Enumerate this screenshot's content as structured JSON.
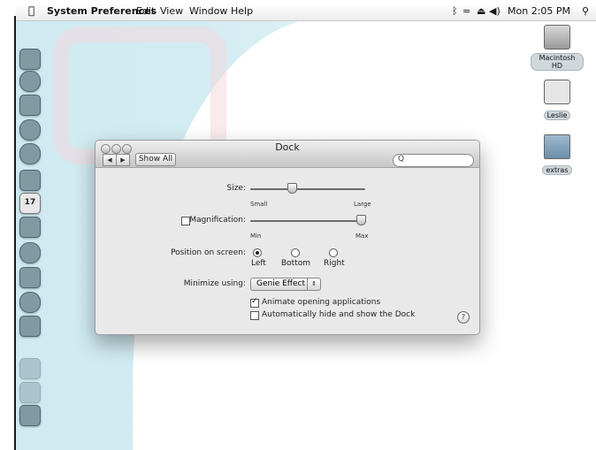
{
  "menubar": {
    "app_name": "System Preferences",
    "items": [
      "Edit",
      "View",
      "Window",
      "Help"
    ],
    "clock": "Mon 2:05 PM"
  },
  "window": {
    "title": "Dock",
    "nav_back": "◀",
    "nav_forward": "▶",
    "show_all": "Show All",
    "search_placeholder": "",
    "size": {
      "label": "Size:",
      "min_label": "Small",
      "max_label": "Large",
      "value": 0.35
    },
    "magnification": {
      "label": "Magnification:",
      "checked": false,
      "min_label": "Min",
      "max_label": "Max",
      "value": 1.0
    },
    "position": {
      "label": "Position on screen:",
      "options": [
        "Left",
        "Bottom",
        "Right"
      ],
      "selected": "Left"
    },
    "minimize": {
      "label": "Minimize using:",
      "value": "Genie Effect"
    },
    "animate_label": "Animate opening applications",
    "animate_checked": true,
    "autohide_label": "Automatically hide and show the Dock",
    "autohide_checked": false,
    "help": "?"
  },
  "desktop_icons": [
    {
      "label": "Macintosh HD",
      "icon": "hard-drive-icon"
    },
    {
      "label": "Leslie",
      "icon": "document-icon"
    },
    {
      "label": "extras",
      "icon": "folder-icon"
    }
  ],
  "dock_icons": [
    "finder-icon",
    "dashboard-icon",
    "mail-icon",
    "safari-icon",
    "ichat-icon",
    "address-book-icon",
    "ical-icon",
    "iphoto-icon",
    "itunes-icon",
    "spaces-icon",
    "time-machine-icon",
    "system-preferences-icon",
    "applications-icon",
    "documents-icon",
    "trash-icon"
  ],
  "ical_date": "17"
}
